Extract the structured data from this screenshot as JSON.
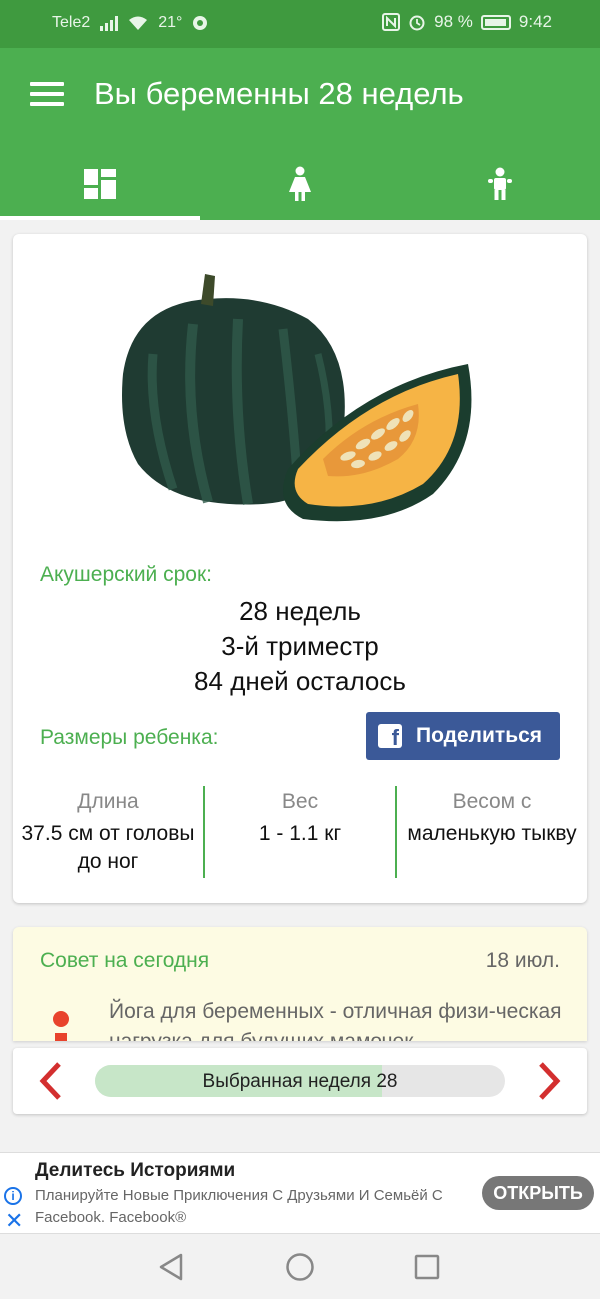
{
  "status_bar": {
    "carrier": "Tele2",
    "temperature": "21°",
    "battery_percent": "98 %",
    "time": "9:42"
  },
  "app_bar": {
    "title": "Вы беременны 28 недель",
    "tabs": [
      {
        "icon": "dashboard-icon",
        "active": true
      },
      {
        "icon": "woman-icon",
        "active": false
      },
      {
        "icon": "baby-icon",
        "active": false
      }
    ]
  },
  "week_card": {
    "image": "acorn-squash",
    "obstetric_label": "Акушерский срок:",
    "weeks": "28 недель",
    "trimester": "3-й триместр",
    "days_left": "84 дней осталось",
    "sizes_label": "Размеры ребенка:",
    "share_label": "Поделиться",
    "stats": [
      {
        "header": "Длина",
        "value": "37.5 см от головы до ног"
      },
      {
        "header": "Вес",
        "value": "1 - 1.1 кг"
      },
      {
        "header": "Весом с",
        "value": "маленькую тыкву"
      }
    ]
  },
  "advice": {
    "title": "Совет на сегодня",
    "date": "18 июл.",
    "text": "Йога для беременных - отличная физи-ческая нагрузка для будущих мамочек"
  },
  "week_selector": {
    "label": "Выбранная неделя 28",
    "progress": 0.7
  },
  "ad": {
    "title": "Делитесь Историями",
    "text": "Планируйте Новые Приключения С Друзьями И Семьёй С Facebook.",
    "brand": "Facebook®",
    "button": "ОТКРЫТЬ"
  },
  "colors": {
    "primary": "#4caf50",
    "primary_dark": "#3f9a3f",
    "facebook": "#3b5998",
    "arrow": "#d32f2f",
    "advice_bg": "#fdfbe3"
  }
}
